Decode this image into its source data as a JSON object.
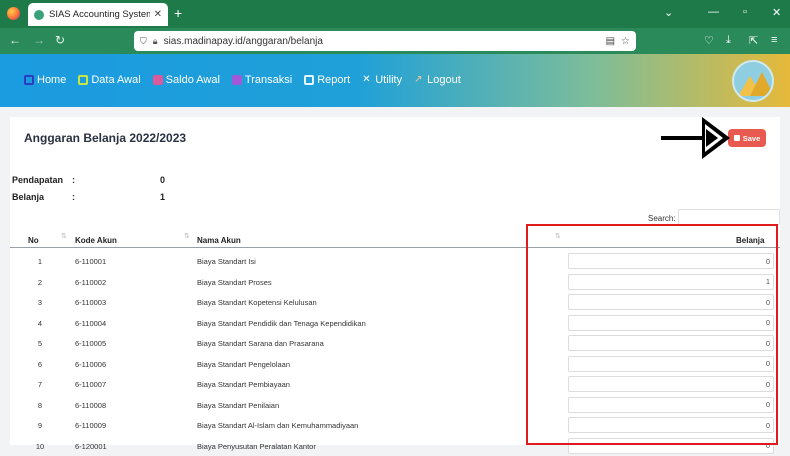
{
  "browser": {
    "tab_title": "SIAS Accounting System",
    "tab_close": "✕",
    "new_tab": "+",
    "url": "sias.madinapay.id/anggaran/belanja",
    "controls": {
      "dropdown": "⌄",
      "minimize": "—",
      "restore": "▫",
      "close": "✕"
    }
  },
  "menu": [
    {
      "label": "Home",
      "icon": "home-icon",
      "color": "#2c3cbe"
    },
    {
      "label": "Data Awal",
      "icon": "monitor-icon",
      "color": "#c8e640"
    },
    {
      "label": "Saldo Awal",
      "icon": "wallet-icon",
      "color": "#d85a9a"
    },
    {
      "label": "Transaksi",
      "icon": "transfer-icon",
      "color": "#a05ad8"
    },
    {
      "label": "Report",
      "icon": "report-icon",
      "color": "#e6f6ff"
    },
    {
      "label": "Utility",
      "icon": "tools-icon",
      "color": "#ffffff"
    },
    {
      "label": "Logout",
      "icon": "logout-icon",
      "color": "#f5c7a0"
    }
  ],
  "page": {
    "title": "Anggaran Belanja 2022/2023",
    "save_label": "Save"
  },
  "summary": [
    {
      "label": "Pendapatan",
      "colon": ":",
      "value": "0"
    },
    {
      "label": "Belanja",
      "colon": ":",
      "value": "1"
    }
  ],
  "search": {
    "label": "Search:",
    "value": ""
  },
  "table": {
    "headers": {
      "no": "No",
      "kode": "Kode Akun",
      "nama": "Nama Akun",
      "belanja": "Belanja"
    },
    "rows": [
      {
        "no": "1",
        "kode": "6-110001",
        "nama": "Biaya Standart Isi",
        "belanja": "0"
      },
      {
        "no": "2",
        "kode": "6-110002",
        "nama": "Biaya Standart Proses",
        "belanja": "1"
      },
      {
        "no": "3",
        "kode": "6-110003",
        "nama": "Biaya Standart Kopetensi Kelulusan",
        "belanja": "0"
      },
      {
        "no": "4",
        "kode": "6-110004",
        "nama": "Biaya Standart Pendidik dan Tenaga Kependidikan",
        "belanja": "0"
      },
      {
        "no": "5",
        "kode": "6-110005",
        "nama": "Biaya Standart Sarana dan Prasarana",
        "belanja": "0"
      },
      {
        "no": "6",
        "kode": "6-110006",
        "nama": "Biaya Standart Pengelolaan",
        "belanja": "0"
      },
      {
        "no": "7",
        "kode": "6-110007",
        "nama": "Biaya Standart Pembiayaan",
        "belanja": "0"
      },
      {
        "no": "8",
        "kode": "6-110008",
        "nama": "Biaya Standart Penilaian",
        "belanja": "0"
      },
      {
        "no": "9",
        "kode": "6-110009",
        "nama": "Biaya Standart Al-Islam dan Kemuhammadiyaan",
        "belanja": "0"
      },
      {
        "no": "10",
        "kode": "6-120001",
        "nama": "Biaya Penyusutan Peralatan Kantor",
        "belanja": "0"
      }
    ]
  }
}
